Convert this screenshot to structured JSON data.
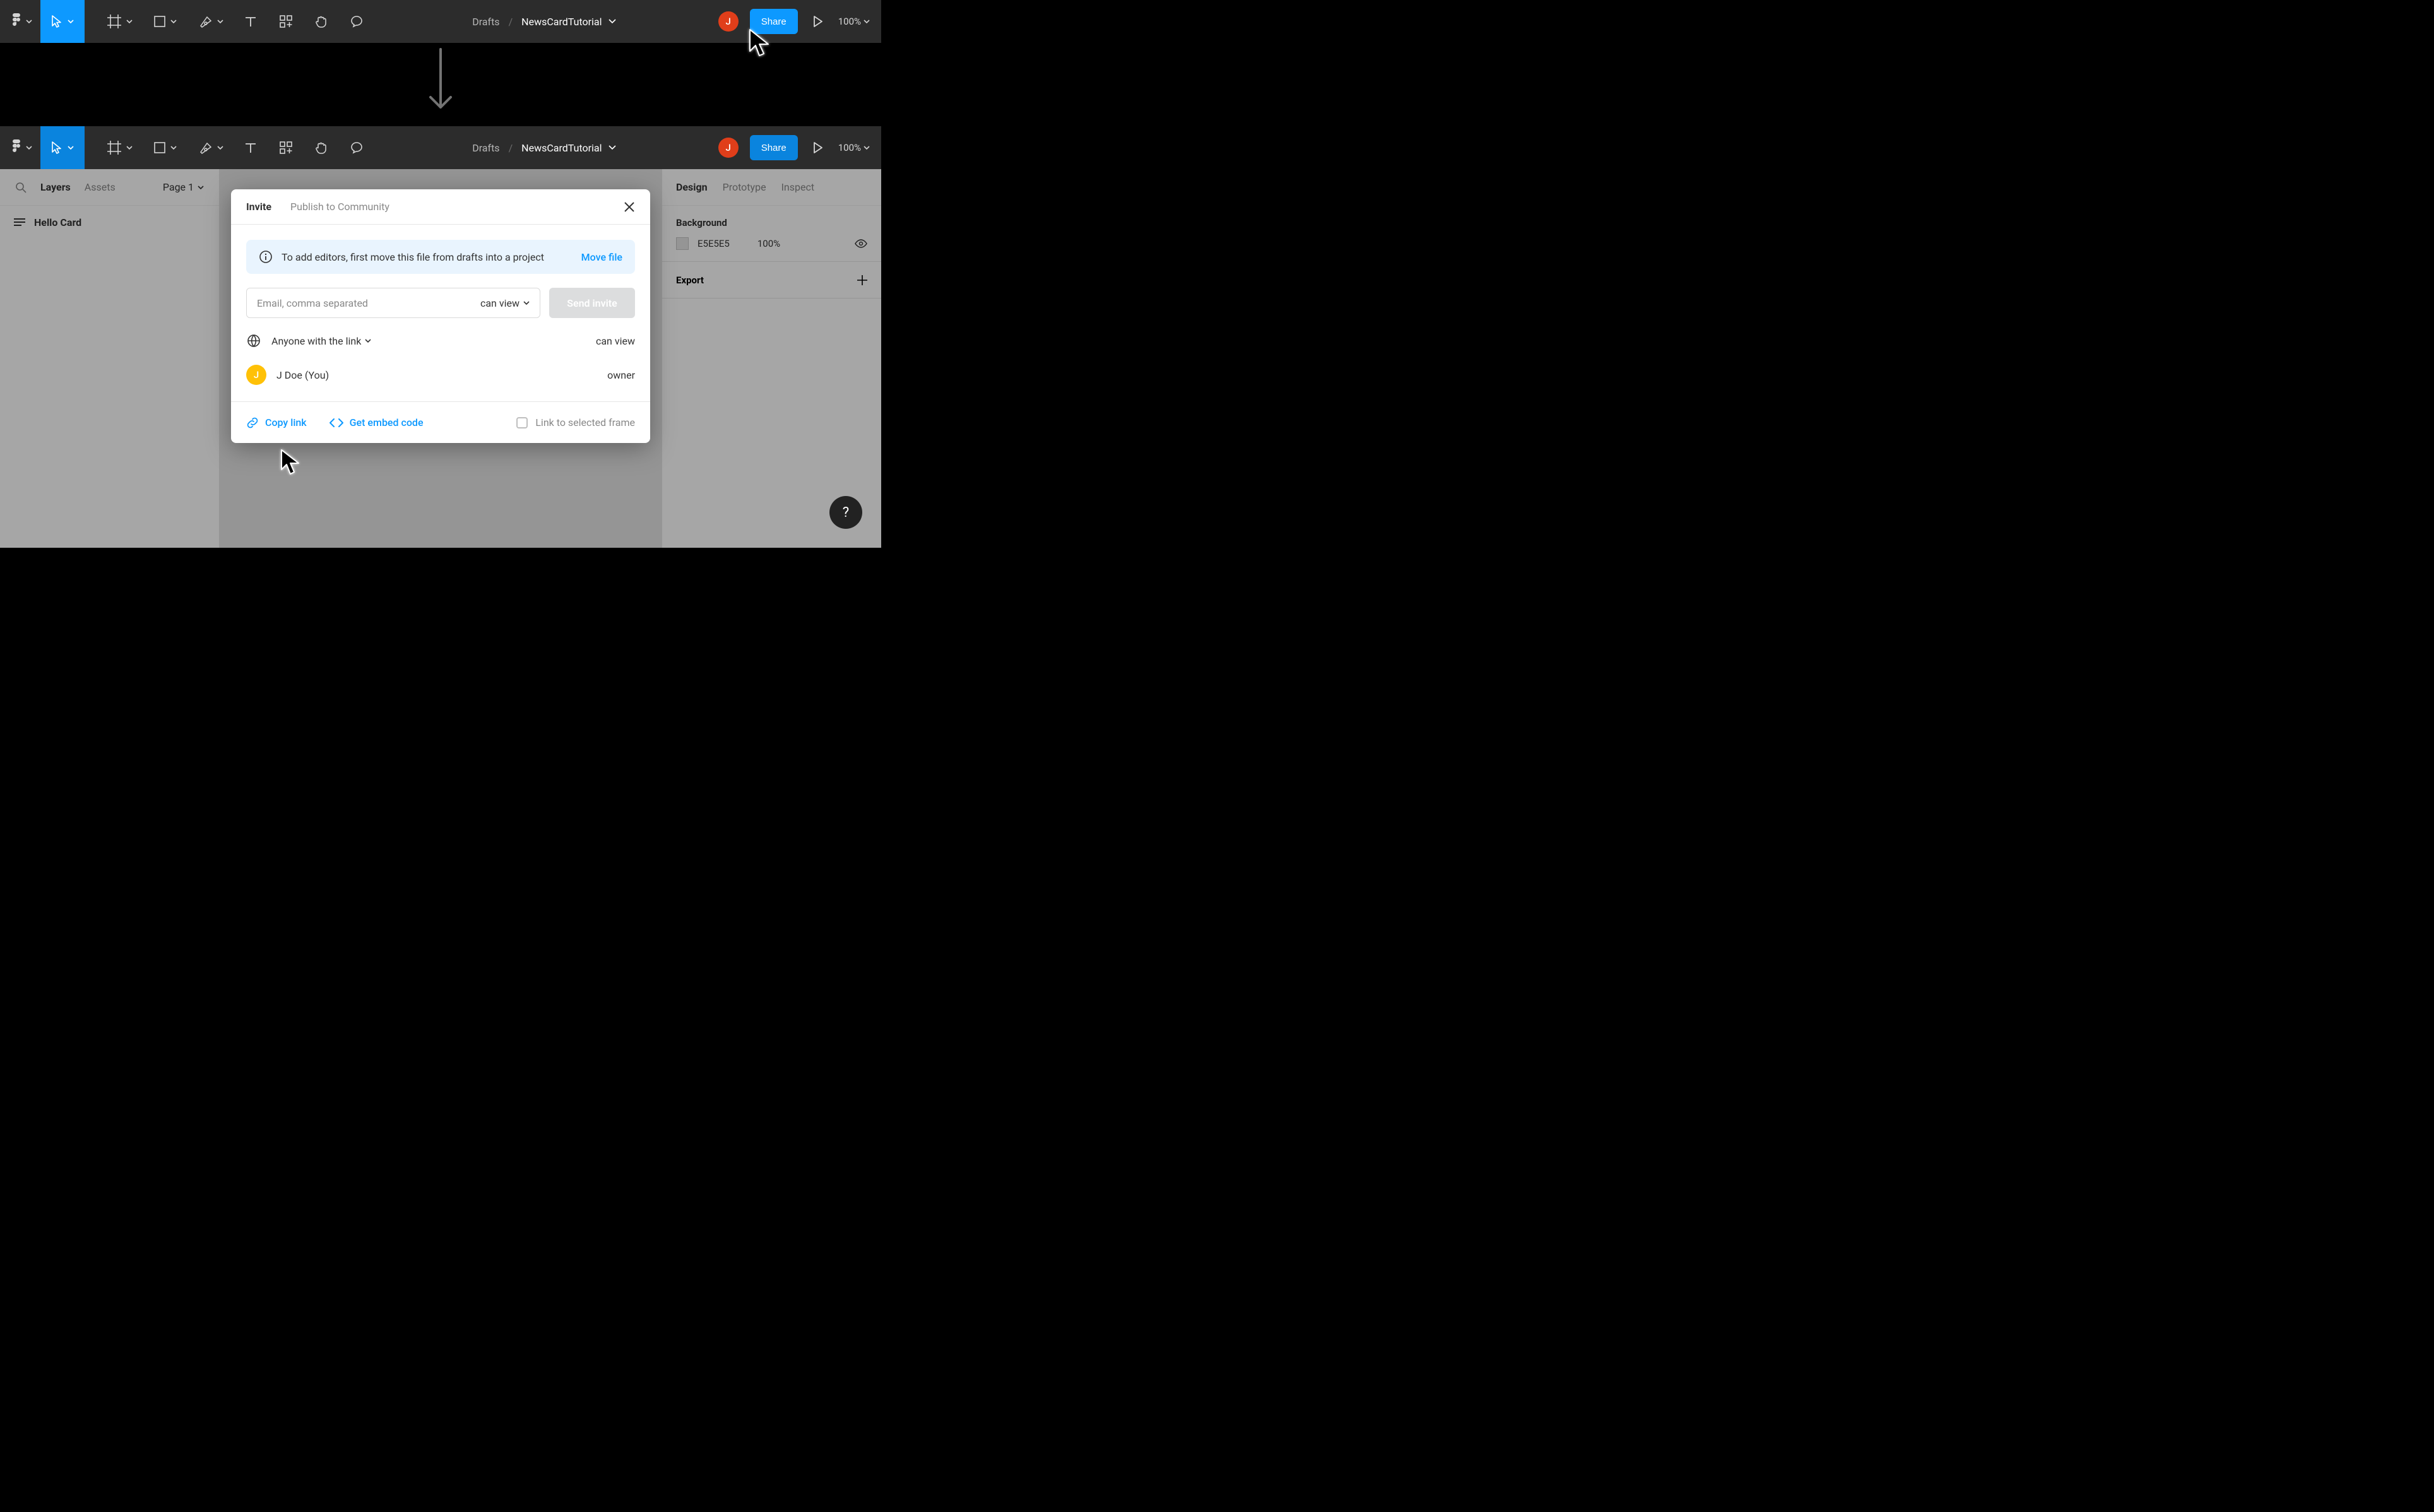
{
  "toolbar": {
    "drafts": "Drafts",
    "file_name": "NewsCardTutorial",
    "share": "Share",
    "zoom": "100%",
    "avatar_initial": "J"
  },
  "left_panel": {
    "tab_layers": "Layers",
    "tab_assets": "Assets",
    "page_label": "Page 1",
    "layer_name": "Hello Card"
  },
  "right_panel": {
    "tab_design": "Design",
    "tab_prototype": "Prototype",
    "tab_inspect": "Inspect",
    "bg_section": "Background",
    "bg_hex": "E5E5E5",
    "bg_opacity": "100%",
    "export_section": "Export"
  },
  "modal": {
    "tab_invite": "Invite",
    "tab_publish": "Publish to Community",
    "info_text": "To add editors, first move this file from drafts into a project",
    "info_action": "Move file",
    "email_placeholder": "Email, comma separated",
    "permission": "can view",
    "send_button": "Send invite",
    "link_access": "Anyone with the link",
    "link_permission": "can view",
    "user_name": "J Doe (You)",
    "user_role": "owner",
    "user_initial": "J",
    "copy_link": "Copy link",
    "embed": "Get embed code",
    "selected_frame": "Link to selected frame"
  },
  "help": "?"
}
